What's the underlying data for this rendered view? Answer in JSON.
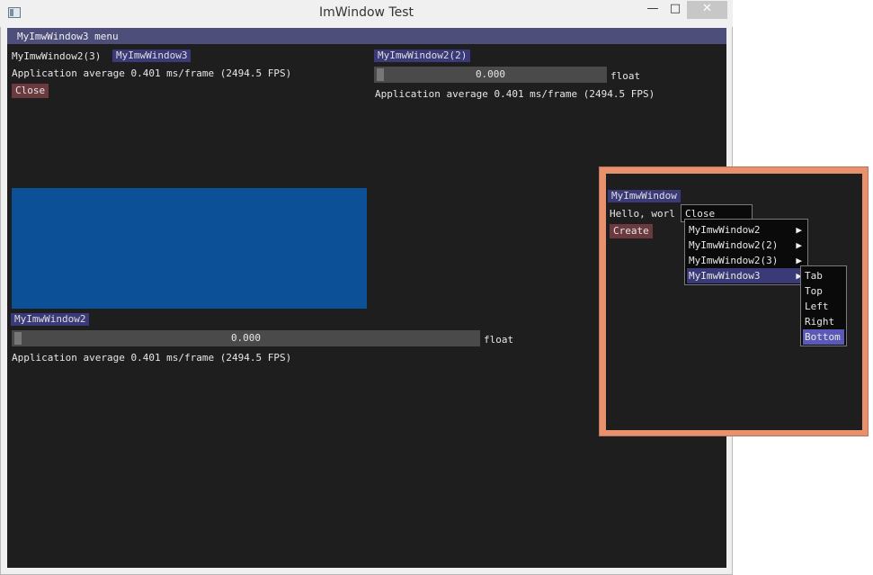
{
  "window": {
    "title": "ImWindow Test",
    "min_glyph": "—",
    "max_glyph": "□",
    "close_glyph": "✕"
  },
  "menubar": {
    "label": "MyImwWindow3 menu"
  },
  "left_top": {
    "label": "MyImwWindow2(3)",
    "tab": "MyImwWindow3",
    "fps": "Application average 0.401 ms/frame (2494.5 FPS)",
    "close_button": "Close"
  },
  "right_top": {
    "tab": "MyImwWindow2(2)",
    "slider_value": "0.000",
    "slider_label": "float",
    "fps": "Application average 0.401 ms/frame (2494.5 FPS)"
  },
  "left_bottom": {
    "tab": "MyImwWindow2",
    "slider_value": "0.000",
    "slider_label": "float",
    "fps": "Application average 0.401 ms/frame (2494.5 FPS)"
  },
  "float_window": {
    "tab": "MyImwWindow",
    "hello": "Hello, worl",
    "create_button": "Create"
  },
  "context_menu": {
    "close": "Close",
    "items": [
      "MyImwWindow2",
      "MyImwWindow2(2)",
      "MyImwWindow2(3)",
      "MyImwWindow3"
    ],
    "arrow_glyph": "▶"
  },
  "submenu": {
    "items": [
      "Tab",
      "Top",
      "Left",
      "Right",
      "Bottom"
    ]
  },
  "colors": {
    "client_bg": "#1e1e1e",
    "menubar": "#4d4e7a",
    "tab_active": "#3b3a78",
    "button": "#6b3a3e",
    "plot_blue": "#0c5198",
    "float_border": "#e8916e",
    "submenu_highlight": "#5a59b8"
  }
}
